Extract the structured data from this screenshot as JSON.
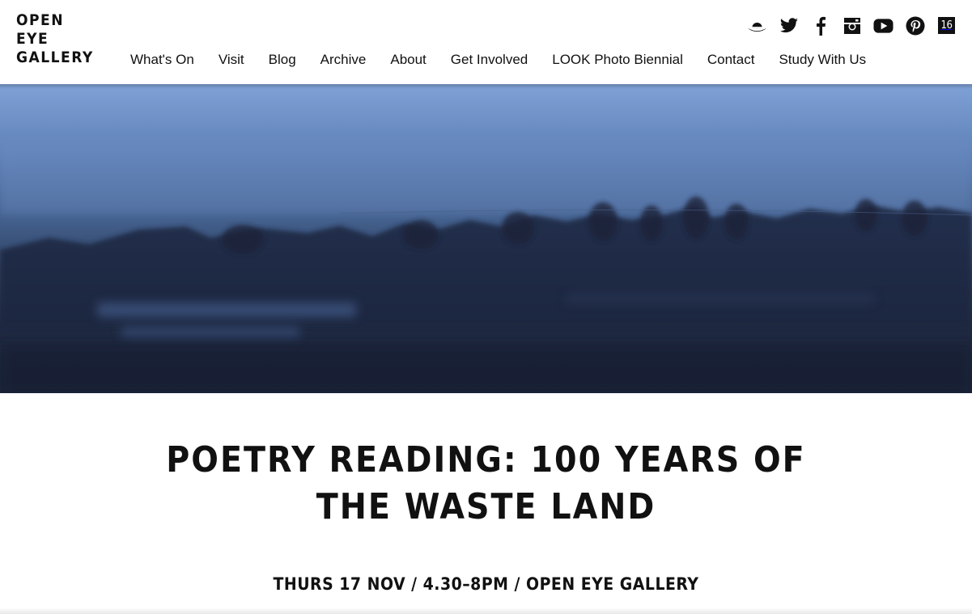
{
  "logo": {
    "lines": [
      "OPEN",
      "EYE",
      "GALLERY"
    ]
  },
  "nav": {
    "items": [
      {
        "label": "What's On"
      },
      {
        "label": "Visit"
      },
      {
        "label": "Blog"
      },
      {
        "label": "Archive"
      },
      {
        "label": "About"
      },
      {
        "label": "Get Involved"
      },
      {
        "label": "LOOK Photo Biennial"
      },
      {
        "label": "Contact"
      },
      {
        "label": "Study With Us"
      }
    ]
  },
  "social": {
    "icons": [
      "hat-icon",
      "twitter-icon",
      "facebook-icon",
      "instagram-icon",
      "youtube-icon",
      "pinterest-icon",
      "sixteen-icon"
    ],
    "sixteen_label": "16"
  },
  "hero": {
    "colors": {
      "sky": "#7fa1d6",
      "mid": "#456391",
      "dark": "#1b2438"
    }
  },
  "event": {
    "title_line1": "POETRY READING: 100 YEARS OF",
    "title_line2": "THE WASTE LAND",
    "subtitle": "THURS 17 NOV / 4.30–8PM / OPEN EYE GALLERY"
  }
}
